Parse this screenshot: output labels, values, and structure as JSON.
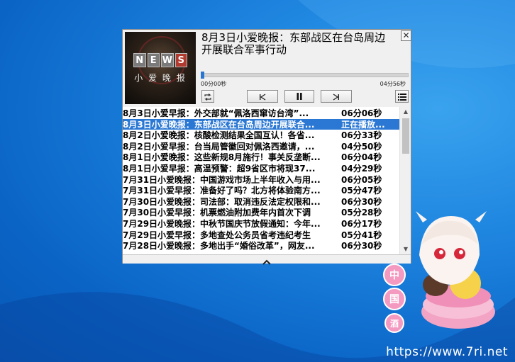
{
  "player": {
    "title": "8月3日小爱晚报：东部战区在台岛周边开展联合军事行动",
    "close_label": "✕",
    "cover": {
      "logo_letters": [
        "N",
        "E",
        "W",
        "S"
      ],
      "subtitle": "小 爱 晚 报"
    },
    "progress": {
      "fraction": 0.0,
      "current": "00分00秒",
      "total": "04分56秒"
    },
    "controls": {
      "loop_icon": "loop-icon",
      "prev_icon": "previous-icon",
      "pause_icon": "pause-icon",
      "next_icon": "next-icon",
      "playlist_icon": "playlist-icon"
    },
    "collapse_icon": "chevron-up-icon"
  },
  "playlist": [
    {
      "title": "8月3日小爱早报：外交部就“佩洛西窜访台湾”...",
      "duration": "06分06秒",
      "selected": false
    },
    {
      "title": "8月3日小爱晚报：东部战区在台岛周边开展联合...",
      "duration": "正在播放...",
      "selected": true
    },
    {
      "title": "8月2日小爱晚报：核酸检测结果全国互认！各省...",
      "duration": "06分33秒",
      "selected": false
    },
    {
      "title": "8月2日小爱早报：台当局管徽回对佩洛西邀请，...",
      "duration": "04分50秒",
      "selected": false
    },
    {
      "title": "8月1日小爱晚报：这些新规8月施行！事关反垄断...",
      "duration": "06分04秒",
      "selected": false
    },
    {
      "title": "8月1日小爱早报：高温预警：超9省区市将现37...",
      "duration": "04分29秒",
      "selected": false
    },
    {
      "title": "7月31日小爱晚报：中国游戏市场上半年收入与用...",
      "duration": "06分05秒",
      "selected": false
    },
    {
      "title": "7月31日小爱早报：准备好了吗？北方将体验南方...",
      "duration": "05分47秒",
      "selected": false
    },
    {
      "title": "7月30日小爱晚报：司法部：取消违反法定权限和...",
      "duration": "06分30秒",
      "selected": false
    },
    {
      "title": "7月30日小爱早报：机票燃油附加费年内首次下调",
      "duration": "05分28秒",
      "selected": false
    },
    {
      "title": "7月29日小爱晚报：中秋节国庆节放假通知：今年...",
      "duration": "06分17秒",
      "selected": false
    },
    {
      "title": "7月29日小爱早报：多地查处公务员省考违纪考生",
      "duration": "05分41秒",
      "selected": false
    },
    {
      "title": "7月28日小爱晚报：多地出手“婚俗改革”，网友...",
      "duration": "06分30秒",
      "selected": false
    }
  ],
  "desktop": {
    "watermark": "https://www.7ri.net",
    "mascot_badges": [
      "中",
      "国",
      "酒"
    ]
  }
}
